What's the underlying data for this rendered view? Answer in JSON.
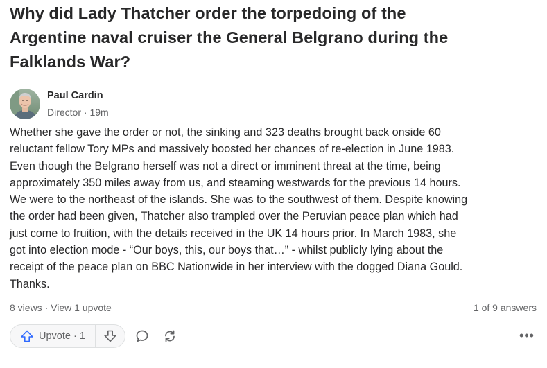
{
  "question": {
    "title_line1": "Why did Lady Thatcher order the torpedoing of the",
    "title_line2": "Argentine naval cruiser the General Belgrano during the",
    "title_line3": "Falklands War?"
  },
  "author": {
    "name": "Paul Cardin",
    "credential": "Director",
    "separator": "·",
    "time": "19m"
  },
  "answer": {
    "lines": [
      "Whether she gave the order or not, the sinking and 323 deaths brought back onside 60",
      "reluctant fellow Tory MPs and massively boosted her chances of re-election in June 1983.",
      "Even though the Belgrano herself was not a direct or imminent threat at the time, being",
      "approximately 350 miles away from us, and steaming westwards for the previous 14 hours.",
      "We were to the northeast of the islands. She was to the southwest of them. Despite knowing",
      "the order had been given, Thatcher also trampled over the Peruvian peace plan which had",
      "just come to fruition, with the details received in the UK 14 hours prior. In March 1983, she",
      "got into election mode - “Our boys, this, our boys that…” - whilst publicly lying about the",
      "receipt of the peace plan on BBC Nationwide in her interview with the dogged Diana Gould.",
      "Thanks."
    ]
  },
  "stats": {
    "views": "8 views",
    "separator": "·",
    "view_upvotes": "View 1 upvote",
    "position": "1 of 9 answers"
  },
  "actions": {
    "upvote_label": "Upvote",
    "upvote_separator": "·",
    "upvote_count": "1",
    "more_label": "•••"
  },
  "colors": {
    "text": "#282829",
    "muted": "#636466",
    "upvote_blue": "#2e69ff",
    "border": "#dee0e1"
  },
  "icons": [
    "avatar-photo",
    "upvote-arrow-icon",
    "downvote-arrow-icon",
    "comment-icon",
    "share-icon",
    "more-icon"
  ]
}
